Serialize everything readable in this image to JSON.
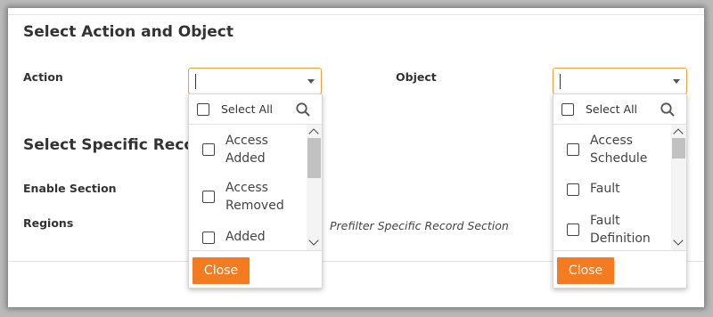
{
  "headings": {
    "select_action_object": "Select Action and Object",
    "select_specific_record": "Select Specific Record"
  },
  "labels": {
    "action": "Action",
    "object": "Object",
    "enable_section": "Enable Section",
    "regions": "Regions"
  },
  "prefilter_text": "Prefilter Specific Record Section",
  "action_dropdown": {
    "select_all": "Select All",
    "options": [
      {
        "line1": "Access",
        "line2": "Added"
      },
      {
        "line1": "Access",
        "line2": "Removed"
      },
      {
        "line1": "Added",
        "line2": ""
      }
    ],
    "close_label": "Close"
  },
  "object_dropdown": {
    "select_all": "Select All",
    "options": [
      {
        "line1": "Access",
        "line2": "Schedule"
      },
      {
        "line1": "Fault",
        "line2": ""
      },
      {
        "line1": "Fault",
        "line2": "Definition"
      }
    ],
    "close_label": "Close"
  },
  "colors": {
    "accent": "#f47b20",
    "focus_border": "#e8a13c"
  },
  "icons": {
    "search": "search-icon",
    "dropdown": "chevron-down-icon",
    "scroll_up": "chevron-up-icon",
    "scroll_down": "chevron-down-icon"
  }
}
